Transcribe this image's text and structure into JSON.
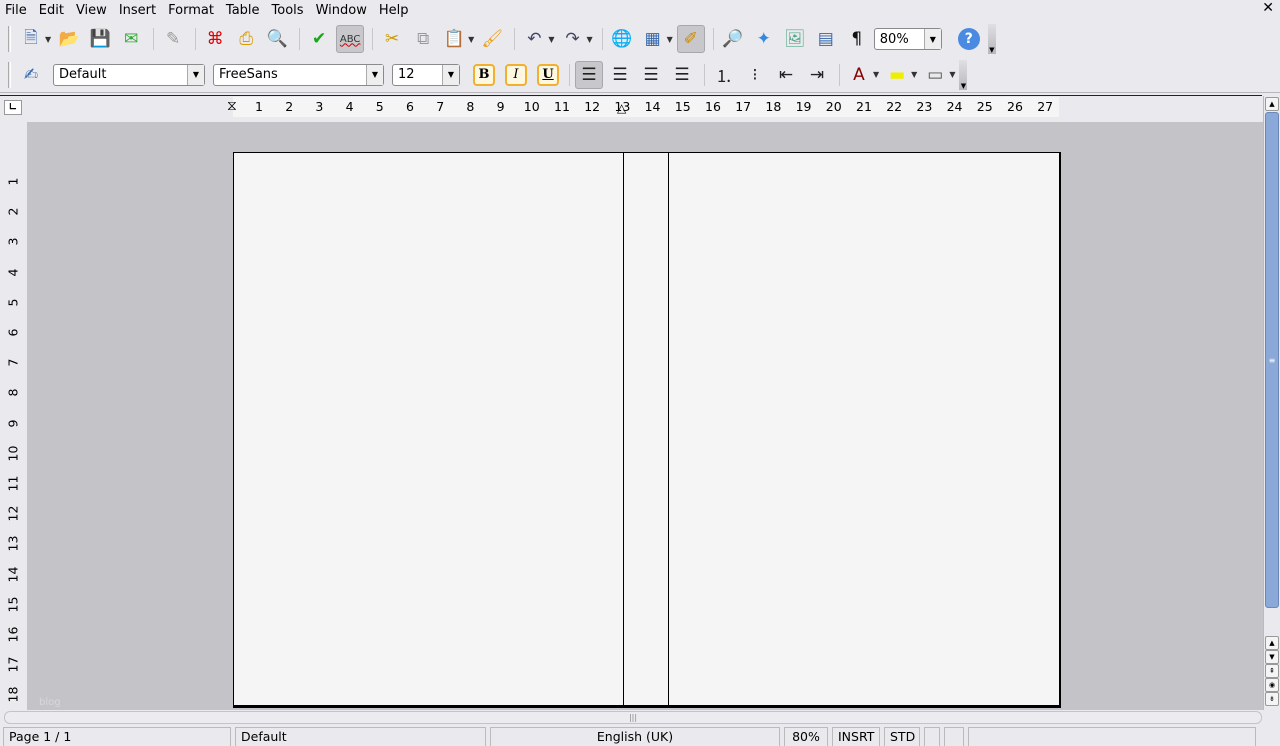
{
  "menu": [
    "File",
    "Edit",
    "View",
    "Insert",
    "Format",
    "Table",
    "Tools",
    "Window",
    "Help"
  ],
  "toolbar1": [
    {
      "icon": "new-document-icon",
      "glyph": "🗎",
      "color": "#3a6ab0",
      "dropdown": true
    },
    {
      "icon": "open-folder-icon",
      "glyph": "📂",
      "color": "#3a80d0"
    },
    {
      "icon": "save-icon",
      "glyph": "💾",
      "color": "#556"
    },
    {
      "icon": "email-document-icon",
      "glyph": "✉",
      "color": "#3a3"
    },
    {
      "sep": true
    },
    {
      "icon": "edit-file-icon",
      "glyph": "✎",
      "color": "#999"
    },
    {
      "sep": true
    },
    {
      "icon": "export-pdf-icon",
      "glyph": "⌘",
      "color": "#d00"
    },
    {
      "icon": "print-icon",
      "glyph": "⎙",
      "color": "#d90"
    },
    {
      "icon": "page-preview-icon",
      "glyph": "🔍",
      "color": "#778"
    },
    {
      "sep": true
    },
    {
      "icon": "spellcheck-icon",
      "glyph": "✔",
      "color": "#1a1"
    },
    {
      "icon": "autospellcheck-icon",
      "glyph": "ABC",
      "color": "#333",
      "active": true
    },
    {
      "sep": true
    },
    {
      "icon": "cut-icon",
      "glyph": "✂",
      "color": "#c90"
    },
    {
      "icon": "copy-icon",
      "glyph": "⧉",
      "color": "#999"
    },
    {
      "icon": "paste-icon",
      "glyph": "📋",
      "color": "#c90",
      "dropdown": true
    },
    {
      "icon": "format-paintbrush-icon",
      "glyph": "🖌",
      "color": "#e8a020"
    },
    {
      "sep": true
    },
    {
      "icon": "undo-icon",
      "glyph": "↶",
      "color": "#446",
      "dropdown": true
    },
    {
      "icon": "redo-icon",
      "glyph": "↷",
      "color": "#446",
      "dropdown": true
    },
    {
      "sep": true
    },
    {
      "icon": "hyperlink-icon",
      "glyph": "🌐",
      "color": "#36a"
    },
    {
      "icon": "table-icon",
      "glyph": "▦",
      "color": "#36a",
      "dropdown": true
    },
    {
      "icon": "show-draw-functions-icon",
      "glyph": "✐",
      "color": "#c80",
      "active": true
    },
    {
      "sep": true
    },
    {
      "icon": "find-replace-icon",
      "glyph": "🔎",
      "color": "#888"
    },
    {
      "icon": "navigator-icon",
      "glyph": "✦",
      "color": "#38d"
    },
    {
      "icon": "gallery-icon",
      "glyph": "🖼",
      "color": "#5a8"
    },
    {
      "icon": "data-sources-icon",
      "glyph": "▤",
      "color": "#36a"
    },
    {
      "icon": "formatting-marks-icon",
      "glyph": "¶",
      "color": "#111"
    }
  ],
  "zoom": {
    "value": "80%"
  },
  "help_icon": "help-icon",
  "paragraph_style": "Default",
  "font_name": "FreeSans",
  "font_size": "12",
  "format": {
    "bold": "B",
    "italic": "I",
    "underline": "U"
  },
  "toolbar2": [
    {
      "icon": "align-left-icon",
      "glyph": "☰",
      "color": "#222",
      "active": true
    },
    {
      "icon": "align-center-icon",
      "glyph": "☰",
      "color": "#222"
    },
    {
      "icon": "align-right-icon",
      "glyph": "☰",
      "color": "#222"
    },
    {
      "icon": "justify-icon",
      "glyph": "☰",
      "color": "#222"
    },
    {
      "sep": true
    },
    {
      "icon": "numbering-icon",
      "glyph": "⒈",
      "color": "#222"
    },
    {
      "icon": "bullets-icon",
      "glyph": "⁝",
      "color": "#222"
    },
    {
      "icon": "decrease-indent-icon",
      "glyph": "⇤",
      "color": "#222"
    },
    {
      "icon": "increase-indent-icon",
      "glyph": "⇥",
      "color": "#222"
    },
    {
      "sep": true
    },
    {
      "icon": "font-color-icon",
      "glyph": "A",
      "color": "#800",
      "dropdown": true
    },
    {
      "icon": "highlighting-icon",
      "glyph": "▬",
      "color": "#ee0",
      "dropdown": true
    },
    {
      "icon": "background-color-icon",
      "glyph": "▭",
      "color": "#555",
      "dropdown": true
    }
  ],
  "ruler": {
    "h": [
      "1",
      "2",
      "3",
      "4",
      "5",
      "6",
      "7",
      "8",
      "9",
      "10",
      "11",
      "12",
      "13",
      "14",
      "15",
      "16",
      "17",
      "18",
      "19",
      "20",
      "21",
      "22",
      "23",
      "24",
      "25",
      "26",
      "27"
    ],
    "v": [
      "1",
      "2",
      "3",
      "4",
      "5",
      "6",
      "7",
      "8",
      "9",
      "10",
      "11",
      "12",
      "13",
      "14",
      "15",
      "16",
      "17",
      "18"
    ]
  },
  "watermark": "blog",
  "status": {
    "page": "Page 1 / 1",
    "style": "Default",
    "language": "English (UK)",
    "zoom": "80%",
    "mode": "INSRT",
    "selection": "STD"
  }
}
